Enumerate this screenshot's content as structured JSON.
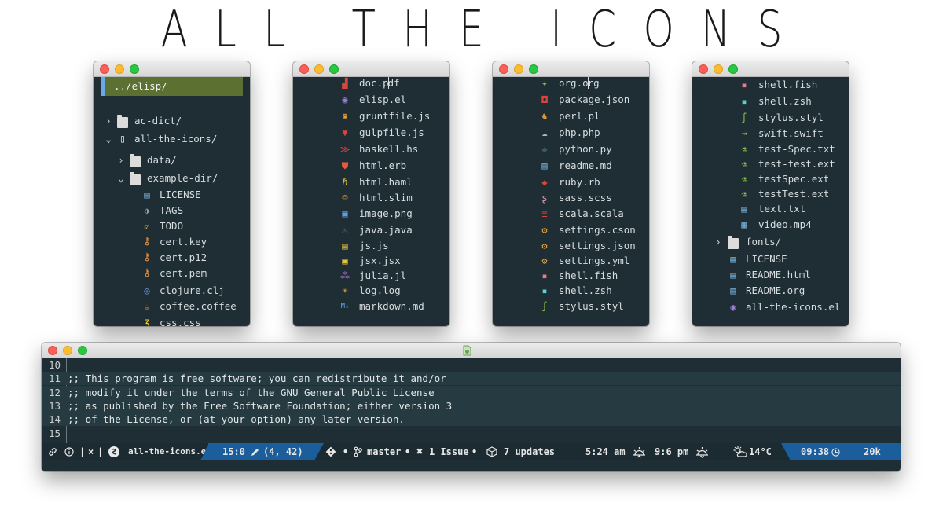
{
  "title": "ALL THE ICONS",
  "colors": {
    "editor_bg": "#1f2e34",
    "highlight": "#5c7032",
    "modeline_blue": "#1c5d9c"
  },
  "window1": {
    "header": "../elisp/",
    "rows": [
      {
        "label": "ac-dict/",
        "icon": "folder-icon",
        "arrow": "›"
      },
      {
        "label": "all-the-icons/",
        "icon": "repo-icon",
        "arrow": "⌄"
      },
      {
        "label": "data/",
        "icon": "folder-icon",
        "arrow": "›"
      },
      {
        "label": "example-dir/",
        "icon": "folder-icon",
        "arrow": "⌄"
      },
      {
        "label": "LICENSE",
        "icon": "book-icon"
      },
      {
        "label": "TAGS",
        "icon": "tag-icon"
      },
      {
        "label": "TODO",
        "icon": "checklist-icon"
      },
      {
        "label": "cert.key",
        "icon": "key-icon"
      },
      {
        "label": "cert.p12",
        "icon": "key-icon"
      },
      {
        "label": "cert.pem",
        "icon": "key-icon"
      },
      {
        "label": "clojure.clj",
        "icon": "clojure-icon"
      },
      {
        "label": "coffee.coffee",
        "icon": "coffee-icon"
      },
      {
        "label": "css.css",
        "icon": "css-icon"
      }
    ]
  },
  "window2": {
    "rows": [
      {
        "label_a": "doc.p",
        "label_b": "df",
        "icon": "pdf-icon"
      },
      {
        "label": "elisp.el",
        "icon": "emacs-icon"
      },
      {
        "label": "gruntfile.js",
        "icon": "grunt-icon"
      },
      {
        "label": "gulpfile.js",
        "icon": "gulp-icon"
      },
      {
        "label": "haskell.hs",
        "icon": "haskell-icon"
      },
      {
        "label": "html.erb",
        "icon": "html5-icon"
      },
      {
        "label": "html.haml",
        "icon": "haml-icon"
      },
      {
        "label": "html.slim",
        "icon": "slim-icon"
      },
      {
        "label": "image.png",
        "icon": "image-icon"
      },
      {
        "label": "java.java",
        "icon": "java-icon"
      },
      {
        "label": "js.js",
        "icon": "javascript-icon"
      },
      {
        "label": "jsx.jsx",
        "icon": "jsx-icon"
      },
      {
        "label": "julia.jl",
        "icon": "julia-icon"
      },
      {
        "label": "log.log",
        "icon": "bug-icon"
      },
      {
        "label": "markdown.md",
        "icon": "markdown-icon"
      }
    ]
  },
  "window3": {
    "rows": [
      {
        "label_a": "org.o",
        "label_b": "rg",
        "icon": "org-unicorn-icon"
      },
      {
        "label": "package.json",
        "icon": "npm-icon"
      },
      {
        "label": "perl.pl",
        "icon": "camel-icon"
      },
      {
        "label": "php.php",
        "icon": "elephant-icon"
      },
      {
        "label": "python.py",
        "icon": "python-icon"
      },
      {
        "label": "readme.md",
        "icon": "book-icon"
      },
      {
        "label": "ruby.rb",
        "icon": "ruby-icon"
      },
      {
        "label": "sass.scss",
        "icon": "sass-icon"
      },
      {
        "label": "scala.scala",
        "icon": "scala-icon"
      },
      {
        "label": "settings.cson",
        "icon": "settings-icon"
      },
      {
        "label": "settings.json",
        "icon": "settings-icon"
      },
      {
        "label": "settings.yml",
        "icon": "settings-icon"
      },
      {
        "label": "shell.fish",
        "icon": "terminal-icon"
      },
      {
        "label": "shell.zsh",
        "icon": "terminal-icon"
      },
      {
        "label": "stylus.styl",
        "icon": "stylus-icon"
      }
    ]
  },
  "window4": {
    "rows": [
      {
        "label": "shell.fish",
        "icon": "terminal-icon"
      },
      {
        "label": "shell.zsh",
        "icon": "terminal-icon"
      },
      {
        "label": "stylus.styl",
        "icon": "stylus-icon"
      },
      {
        "label": "swift.swift",
        "icon": "swift-icon"
      },
      {
        "label": "test-Spec.txt",
        "icon": "flask-icon"
      },
      {
        "label": "test-test.ext",
        "icon": "flask-icon"
      },
      {
        "label": "testSpec.ext",
        "icon": "flask-icon"
      },
      {
        "label": "testTest.ext",
        "icon": "flask-icon"
      },
      {
        "label": "text.txt",
        "icon": "file-text-icon"
      },
      {
        "label": "video.mp4",
        "icon": "film-icon"
      },
      {
        "label": "fonts/",
        "icon": "folder-icon",
        "arrow": "›"
      },
      {
        "label": "LICENSE",
        "icon": "book-icon"
      },
      {
        "label": "README.html",
        "icon": "book-icon"
      },
      {
        "label": "README.org",
        "icon": "book-icon"
      },
      {
        "label": "all-the-icons.el",
        "icon": "emacs-icon"
      }
    ]
  },
  "editor": {
    "lines": [
      {
        "num": "10",
        "text": ""
      },
      {
        "num": "11",
        "text": ";; This program is free software; you can redistribute it and/or"
      },
      {
        "num": "12",
        "text": ";; modify it under the terms of the GNU General Public License"
      },
      {
        "num": "13",
        "text": ";; as published by the Free Software Foundation; either version 3"
      },
      {
        "num": "14",
        "text": ";; of the License, or (at your option) any later version."
      },
      {
        "num": "15",
        "text": ""
      }
    ]
  },
  "modeline": {
    "sep1": "|",
    "close": "×",
    "sep2": "|",
    "buffer": "all-the-icons.el",
    "position": "15:0",
    "coords": "(4, 42)",
    "bullet": "•",
    "branch": "master",
    "issues": "1 Issue",
    "updates": "7 updates",
    "sunrise": "5:24 am",
    "sunset": "9:6 pm",
    "temp": "14°C",
    "time": "09:38",
    "size": "20k"
  }
}
